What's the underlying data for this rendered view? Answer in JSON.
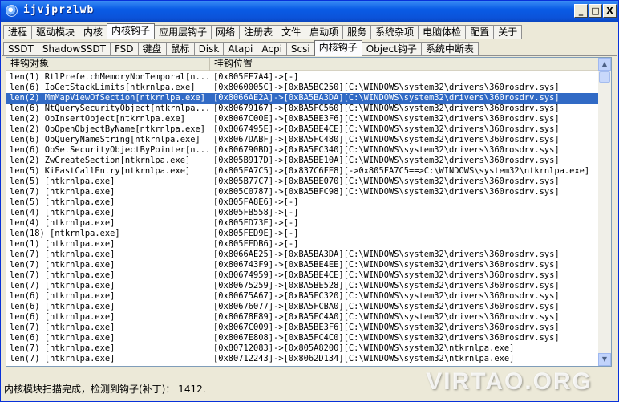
{
  "window": {
    "title": "ijvjprzlwb",
    "minimize_glyph": "_",
    "maximize_glyph": "□",
    "close_glyph": "X"
  },
  "main_tabs": [
    "进程",
    "驱动模块",
    "内核",
    "内核钩子",
    "应用层钩子",
    "网络",
    "注册表",
    "文件",
    "启动项",
    "服务",
    "系统杂项",
    "电脑体检",
    "配置",
    "关于"
  ],
  "main_tab_active": "内核钩子",
  "sub_tabs": [
    "SSDT",
    "ShadowSSDT",
    "FSD",
    "键盘",
    "鼠标",
    "Disk",
    "Atapi",
    "Acpi",
    "Scsi",
    "内核钩子",
    "Object钩子",
    "系统中断表"
  ],
  "sub_tab_active": "内核钩子",
  "columns": [
    "挂钩对象",
    "挂钩位置"
  ],
  "rows": [
    [
      "len(1) RtlPrefetchMemoryNonTemporal[n...",
      "[0x805FF7A4]->[-]"
    ],
    [
      "len(6) IoGetStackLimits[ntkrnlpa.exe]",
      "[0x8060005C]->[0xBA5BC250][C:\\WINDOWS\\system32\\drivers\\360rosdrv.sys]"
    ],
    [
      "len(2) MmMapViewOfSection[ntkrnlpa.exe]",
      "[0x8066AE2A]->[0xBA5BA3DA][C:\\WINDOWS\\system32\\drivers\\360rosdrv.sys]"
    ],
    [
      "len(6) NtQuerySecurityObject[ntkrnlpa...",
      "[0x80679167]->[0xBA5FC560][C:\\WINDOWS\\system32\\drivers\\360rosdrv.sys]"
    ],
    [
      "len(2) ObInsertObject[ntkrnlpa.exe]",
      "[0x8067C00E]->[0xBA5BE3F6][C:\\WINDOWS\\system32\\drivers\\360rosdrv.sys]"
    ],
    [
      "len(2) ObOpenObjectByName[ntkrnlpa.exe]",
      "[0x8067495E]->[0xBA5BE4CE][C:\\WINDOWS\\system32\\drivers\\360rosdrv.sys]"
    ],
    [
      "len(6) ObQueryNameString[ntkrnlpa.exe]",
      "[0x8067DABF]->[0xBA5FC480][C:\\WINDOWS\\system32\\drivers\\360rosdrv.sys]"
    ],
    [
      "len(6) ObSetSecurityObjectByPointer[n...",
      "[0x806790BD]->[0xBA5FC340][C:\\WINDOWS\\system32\\drivers\\360rosdrv.sys]"
    ],
    [
      "len(2) ZwCreateSection[ntkrnlpa.exe]",
      "[0x805B917D]->[0xBA5BE10A][C:\\WINDOWS\\system32\\drivers\\360rosdrv.sys]"
    ],
    [
      "len(5) KiFastCallEntry[ntkrnlpa.exe]",
      "[0x805FA7C5]->[0x837C6FE8][->0x805FA7C5==>C:\\WINDOWS\\system32\\ntkrnlpa.exe]"
    ],
    [
      "len(5) [ntkrnlpa.exe]",
      "[0x805B77C7]->[0xBA5BE070][C:\\WINDOWS\\system32\\drivers\\360rosdrv.sys]"
    ],
    [
      "len(7) [ntkrnlpa.exe]",
      "[0x805C0787]->[0xBA5BFC98][C:\\WINDOWS\\system32\\drivers\\360rosdrv.sys]"
    ],
    [
      "len(5) [ntkrnlpa.exe]",
      "[0x805FA8E6]->[-]"
    ],
    [
      "len(4) [ntkrnlpa.exe]",
      "[0x805FB558]->[-]"
    ],
    [
      "len(4) [ntkrnlpa.exe]",
      "[0x805FD73E]->[-]"
    ],
    [
      "len(18) [ntkrnlpa.exe]",
      "[0x805FED9E]->[-]"
    ],
    [
      "len(1) [ntkrnlpa.exe]",
      "[0x805FEDB6]->[-]"
    ],
    [
      "len(7) [ntkrnlpa.exe]",
      "[0x8066AE25]->[0xBA5BA3DA][C:\\WINDOWS\\system32\\drivers\\360rosdrv.sys]"
    ],
    [
      "len(7) [ntkrnlpa.exe]",
      "[0x806743F9]->[0xBA5BE4EE][C:\\WINDOWS\\system32\\drivers\\360rosdrv.sys]"
    ],
    [
      "len(7) [ntkrnlpa.exe]",
      "[0x80674959]->[0xBA5BE4CE][C:\\WINDOWS\\system32\\drivers\\360rosdrv.sys]"
    ],
    [
      "len(7) [ntkrnlpa.exe]",
      "[0x80675259]->[0xBA5BE528][C:\\WINDOWS\\system32\\drivers\\360rosdrv.sys]"
    ],
    [
      "len(6) [ntkrnlpa.exe]",
      "[0x80675A67]->[0xBA5FC320][C:\\WINDOWS\\system32\\drivers\\360rosdrv.sys]"
    ],
    [
      "len(6) [ntkrnlpa.exe]",
      "[0x80676077]->[0xBA5FCBA0][C:\\WINDOWS\\system32\\drivers\\360rosdrv.sys]"
    ],
    [
      "len(6) [ntkrnlpa.exe]",
      "[0x80678E89]->[0xBA5FC4A0][C:\\WINDOWS\\system32\\drivers\\360rosdrv.sys]"
    ],
    [
      "len(7) [ntkrnlpa.exe]",
      "[0x8067C009]->[0xBA5BE3F6][C:\\WINDOWS\\system32\\drivers\\360rosdrv.sys]"
    ],
    [
      "len(6) [ntkrnlpa.exe]",
      "[0x8067E808]->[0xBA5FC4C0][C:\\WINDOWS\\system32\\drivers\\360rosdrv.sys]"
    ],
    [
      "len(7) [ntkrnlpa.exe]",
      "[0x80712083]->[0x805A8200][C:\\WINDOWS\\system32\\ntkrnlpa.exe]"
    ],
    [
      "len(7) [ntkrnlpa.exe]",
      "[0x80712243]->[0x8062D134][C:\\WINDOWS\\system32\\ntkrnlpa.exe]"
    ]
  ],
  "selected_row": 2,
  "status": "内核模块扫描完成，检测到钩子(补丁)： 1412.",
  "watermark": "VIRTAO.ORG",
  "colors": {
    "titlebar": "#0a5ce6",
    "selection": "#316ac5",
    "face": "#ece9d8"
  }
}
